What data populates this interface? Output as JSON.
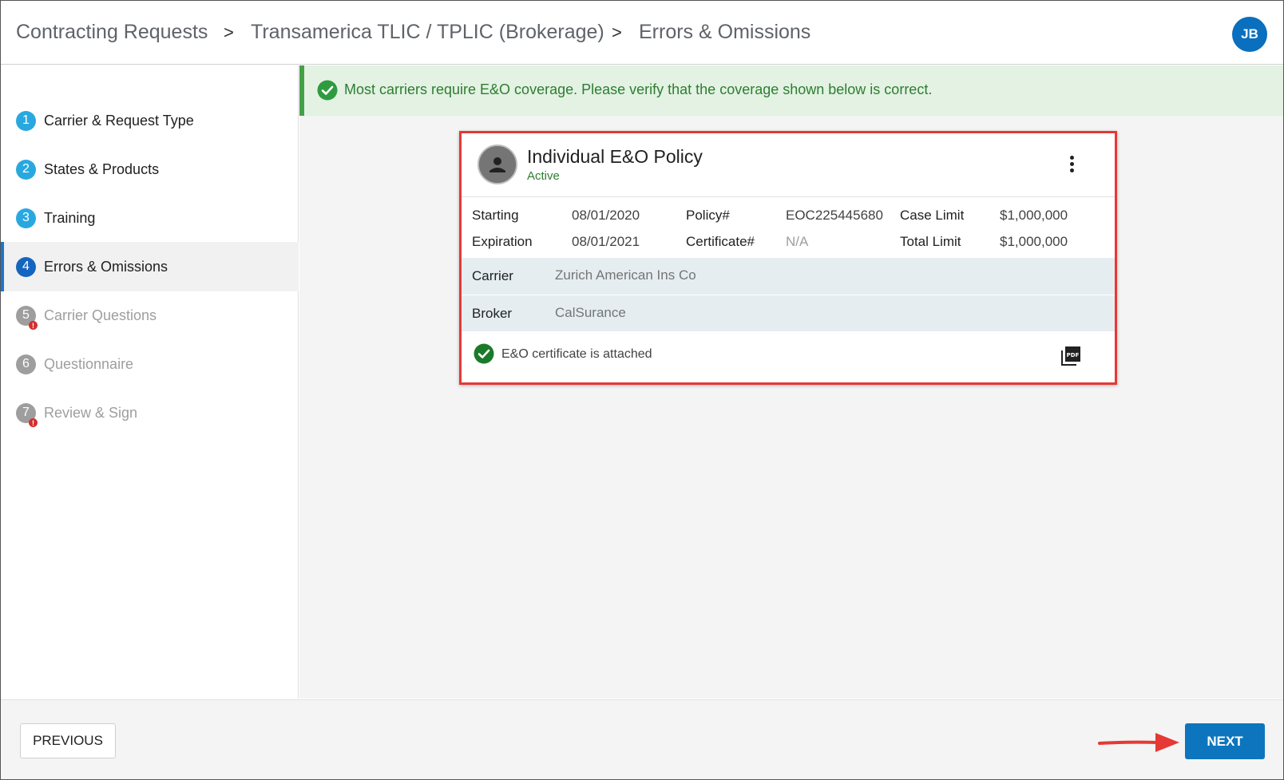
{
  "header": {
    "breadcrumbs": [
      "Contracting Requests",
      "Transamerica TLIC / TPLIC (Brokerage)",
      "Errors & Omissions"
    ],
    "separator": ">",
    "avatar_initials": "JB"
  },
  "sidebar": {
    "steps": [
      {
        "number": "1",
        "label": "Carrier & Request Type",
        "state": "done"
      },
      {
        "number": "2",
        "label": "States & Products",
        "state": "done"
      },
      {
        "number": "3",
        "label": "Training",
        "state": "done"
      },
      {
        "number": "4",
        "label": "Errors & Omissions",
        "state": "active"
      },
      {
        "number": "5",
        "label": "Carrier Questions",
        "state": "todo",
        "error": true
      },
      {
        "number": "6",
        "label": "Questionnaire",
        "state": "todo"
      },
      {
        "number": "7",
        "label": "Review & Sign",
        "state": "todo",
        "error": true
      }
    ]
  },
  "banner": {
    "text": "Most carriers require E&O coverage. Please verify that the coverage shown below is correct.",
    "icon": "check-circle-icon"
  },
  "policy_card": {
    "title": "Individual E&O Policy",
    "status": "Active",
    "starting_label": "Starting",
    "starting_value": "08/01/2020",
    "expiration_label": "Expiration",
    "expiration_value": "08/01/2021",
    "policy_label": "Policy#",
    "policy_value": "EOC225445680",
    "certificate_label": "Certificate#",
    "certificate_value": "N/A",
    "case_limit_label": "Case Limit",
    "case_limit_value": "$1,000,000",
    "total_limit_label": "Total Limit",
    "total_limit_value": "$1,000,000",
    "carrier_label": "Carrier",
    "carrier_value": "Zurich American Ins Co",
    "broker_label": "Broker",
    "broker_value": "CalSurance",
    "attachment_text": "E&O certificate is attached",
    "pdf_icon_text": "PDF"
  },
  "footer": {
    "previous_label": "PREVIOUS",
    "next_label": "NEXT"
  },
  "colors": {
    "accent": "#0d75bd",
    "success": "#2e7d32",
    "highlight_border": "#e53935",
    "annotation_arrow": "#e53935"
  }
}
